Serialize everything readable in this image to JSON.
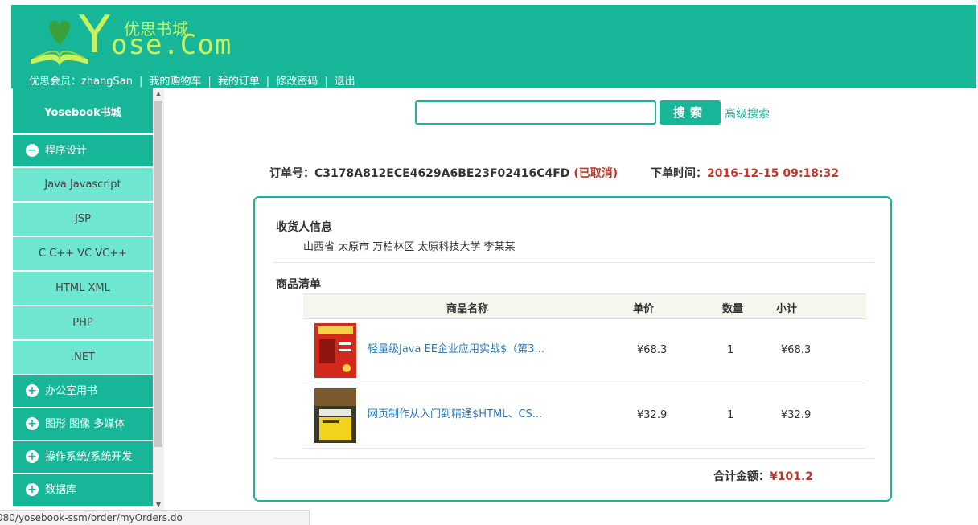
{
  "brand": {
    "logo_text": "Yose.Com",
    "logo_big": "Y",
    "logo_rest": "ose.Com",
    "logo_cn": "优思书城",
    "color_main": "#18b699",
    "color_accent": "#c8f15b"
  },
  "nav": {
    "member_label": "优思会员：zhangSan",
    "cart": "我的购物车",
    "orders": "我的订单",
    "password": "修改密码",
    "logout": "退出",
    "separator": "|"
  },
  "sidebar": {
    "title": "Yosebook书城",
    "categories": [
      {
        "label": "程序设计",
        "icon": "minus-circle-icon",
        "expanded": true,
        "subs": [
          "Java Javascript",
          "JSP",
          "C C++ VC VC++",
          "HTML XML",
          "PHP",
          ".NET"
        ]
      },
      {
        "label": "办公室用书",
        "icon": "plus-circle-icon"
      },
      {
        "label": "图形 图像 多媒体",
        "icon": "plus-circle-icon"
      },
      {
        "label": "操作系统/系统开发",
        "icon": "plus-circle-icon"
      },
      {
        "label": "数据库",
        "icon": "plus-circle-icon"
      }
    ]
  },
  "search": {
    "value": "",
    "button": "搜索",
    "advanced": "高级搜索"
  },
  "order": {
    "id_label": "订单号：",
    "id": "C3178A812ECE4629A6BE23F02416C4FD",
    "status": "(已取消)",
    "time_label": "下单时间：",
    "time": "2016-12-15 09:18:32"
  },
  "receiver": {
    "title": "收货人信息",
    "address": "山西省 太原市 万柏林区 太原科技大学 李某某"
  },
  "items_section": {
    "title": "商品清单",
    "headers": [
      "商品名称",
      "单价",
      "数量",
      "小计"
    ],
    "rows": [
      {
        "name": "轻量级Java EE企业应用实战$（第3...",
        "price": "¥68.3",
        "qty": "1",
        "subtotal": "¥68.3",
        "cover": "red-book-cover"
      },
      {
        "name": "网页制作从入门到精通$HTML、CS...",
        "price": "¥32.9",
        "qty": "1",
        "subtotal": "¥32.9",
        "cover": "yellow-book-cover"
      }
    ]
  },
  "total": {
    "label": "合计金额：",
    "amount": "¥101.2"
  },
  "statusbar": {
    "url": "080/yosebook-ssm/order/myOrders.do"
  }
}
